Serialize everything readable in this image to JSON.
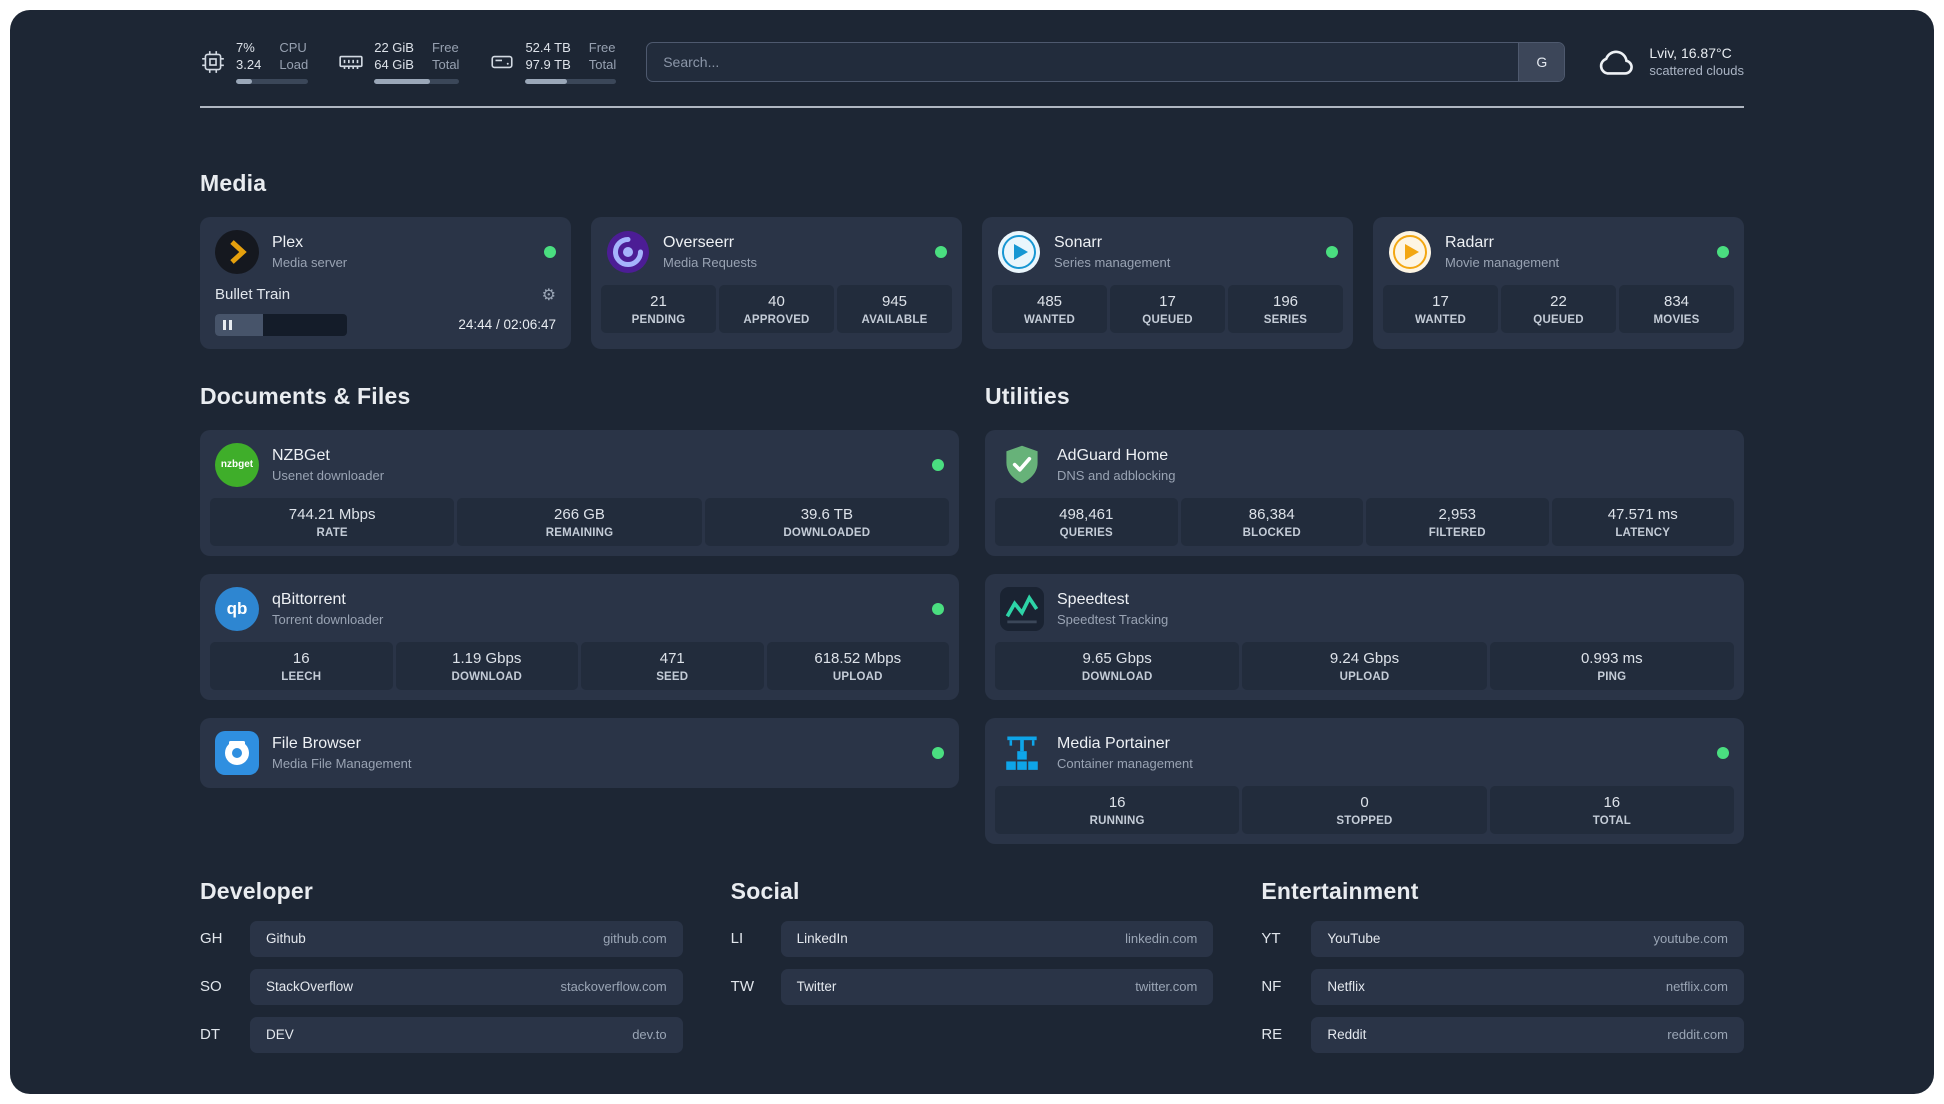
{
  "theme": {
    "status_online_color": "#4ade80",
    "accent_plex": "#e5a00d"
  },
  "icons": {
    "gear": "⚙",
    "qbittorrent_text": "qb",
    "nzbget_text": "nzbget"
  },
  "topbar": {
    "cpu": {
      "value_top": "7%",
      "value_bottom": "3.24",
      "label_top": "CPU",
      "label_bottom": "Load",
      "progress_pct": 22
    },
    "memory": {
      "value_top": "22 GiB",
      "value_bottom": "64 GiB",
      "label_top": "Free",
      "label_bottom": "Total",
      "progress_pct": 66
    },
    "disk": {
      "value_top": "52.4 TB",
      "value_bottom": "97.9 TB",
      "label_top": "Free",
      "label_bottom": "Total",
      "progress_pct": 46
    },
    "search": {
      "placeholder": "Search...",
      "provider": "G"
    },
    "weather": {
      "location": "Lviv, 16.87°C",
      "condition": "scattered clouds"
    }
  },
  "sections": {
    "media": {
      "title": "Media",
      "cards": [
        {
          "name": "Plex",
          "desc": "Media server",
          "status": "online",
          "player": {
            "track": "Bullet Train",
            "time": "24:44 / 02:06:47",
            "progress_pct": 36
          }
        },
        {
          "name": "Overseerr",
          "desc": "Media Requests",
          "status": "online",
          "stats": [
            {
              "value": "21",
              "label": "PENDING"
            },
            {
              "value": "40",
              "label": "APPROVED"
            },
            {
              "value": "945",
              "label": "AVAILABLE"
            }
          ]
        },
        {
          "name": "Sonarr",
          "desc": "Series management",
          "status": "online",
          "stats": [
            {
              "value": "485",
              "label": "WANTED"
            },
            {
              "value": "17",
              "label": "QUEUED"
            },
            {
              "value": "196",
              "label": "SERIES"
            }
          ]
        },
        {
          "name": "Radarr",
          "desc": "Movie management",
          "status": "online",
          "stats": [
            {
              "value": "17",
              "label": "WANTED"
            },
            {
              "value": "22",
              "label": "QUEUED"
            },
            {
              "value": "834",
              "label": "MOVIES"
            }
          ]
        }
      ]
    },
    "documents": {
      "title": "Documents & Files",
      "cards": [
        {
          "name": "NZBGet",
          "desc": "Usenet downloader",
          "status": "online",
          "stats": [
            {
              "value": "744.21 Mbps",
              "label": "RATE"
            },
            {
              "value": "266 GB",
              "label": "REMAINING"
            },
            {
              "value": "39.6 TB",
              "label": "DOWNLOADED"
            }
          ]
        },
        {
          "name": "qBittorrent",
          "desc": "Torrent downloader",
          "status": "online",
          "stats": [
            {
              "value": "16",
              "label": "LEECH"
            },
            {
              "value": "1.19 Gbps",
              "label": "DOWNLOAD"
            },
            {
              "value": "471",
              "label": "SEED"
            },
            {
              "value": "618.52 Mbps",
              "label": "UPLOAD"
            }
          ]
        },
        {
          "name": "File Browser",
          "desc": "Media File Management",
          "status": "online"
        }
      ]
    },
    "utilities": {
      "title": "Utilities",
      "cards": [
        {
          "name": "AdGuard Home",
          "desc": "DNS and adblocking",
          "stats": [
            {
              "value": "498,461",
              "label": "QUERIES"
            },
            {
              "value": "86,384",
              "label": "BLOCKED"
            },
            {
              "value": "2,953",
              "label": "FILTERED"
            },
            {
              "value": "47.571 ms",
              "label": "LATENCY"
            }
          ]
        },
        {
          "name": "Speedtest",
          "desc": "Speedtest Tracking",
          "stats": [
            {
              "value": "9.65 Gbps",
              "label": "DOWNLOAD"
            },
            {
              "value": "9.24 Gbps",
              "label": "UPLOAD"
            },
            {
              "value": "0.993 ms",
              "label": "PING"
            }
          ]
        },
        {
          "name": "Media Portainer",
          "desc": "Container management",
          "status": "online",
          "stats": [
            {
              "value": "16",
              "label": "RUNNING"
            },
            {
              "value": "0",
              "label": "STOPPED"
            },
            {
              "value": "16",
              "label": "TOTAL"
            }
          ]
        }
      ]
    }
  },
  "bookmarks": [
    {
      "title": "Developer",
      "items": [
        {
          "abbr": "GH",
          "name": "Github",
          "domain": "github.com"
        },
        {
          "abbr": "SO",
          "name": "StackOverflow",
          "domain": "stackoverflow.com"
        },
        {
          "abbr": "DT",
          "name": "DEV",
          "domain": "dev.to"
        }
      ]
    },
    {
      "title": "Social",
      "items": [
        {
          "abbr": "LI",
          "name": "LinkedIn",
          "domain": "linkedin.com"
        },
        {
          "abbr": "TW",
          "name": "Twitter",
          "domain": "twitter.com"
        }
      ]
    },
    {
      "title": "Entertainment",
      "items": [
        {
          "abbr": "YT",
          "name": "YouTube",
          "domain": "youtube.com"
        },
        {
          "abbr": "NF",
          "name": "Netflix",
          "domain": "netflix.com"
        },
        {
          "abbr": "RE",
          "name": "Reddit",
          "domain": "reddit.com"
        }
      ]
    }
  ]
}
